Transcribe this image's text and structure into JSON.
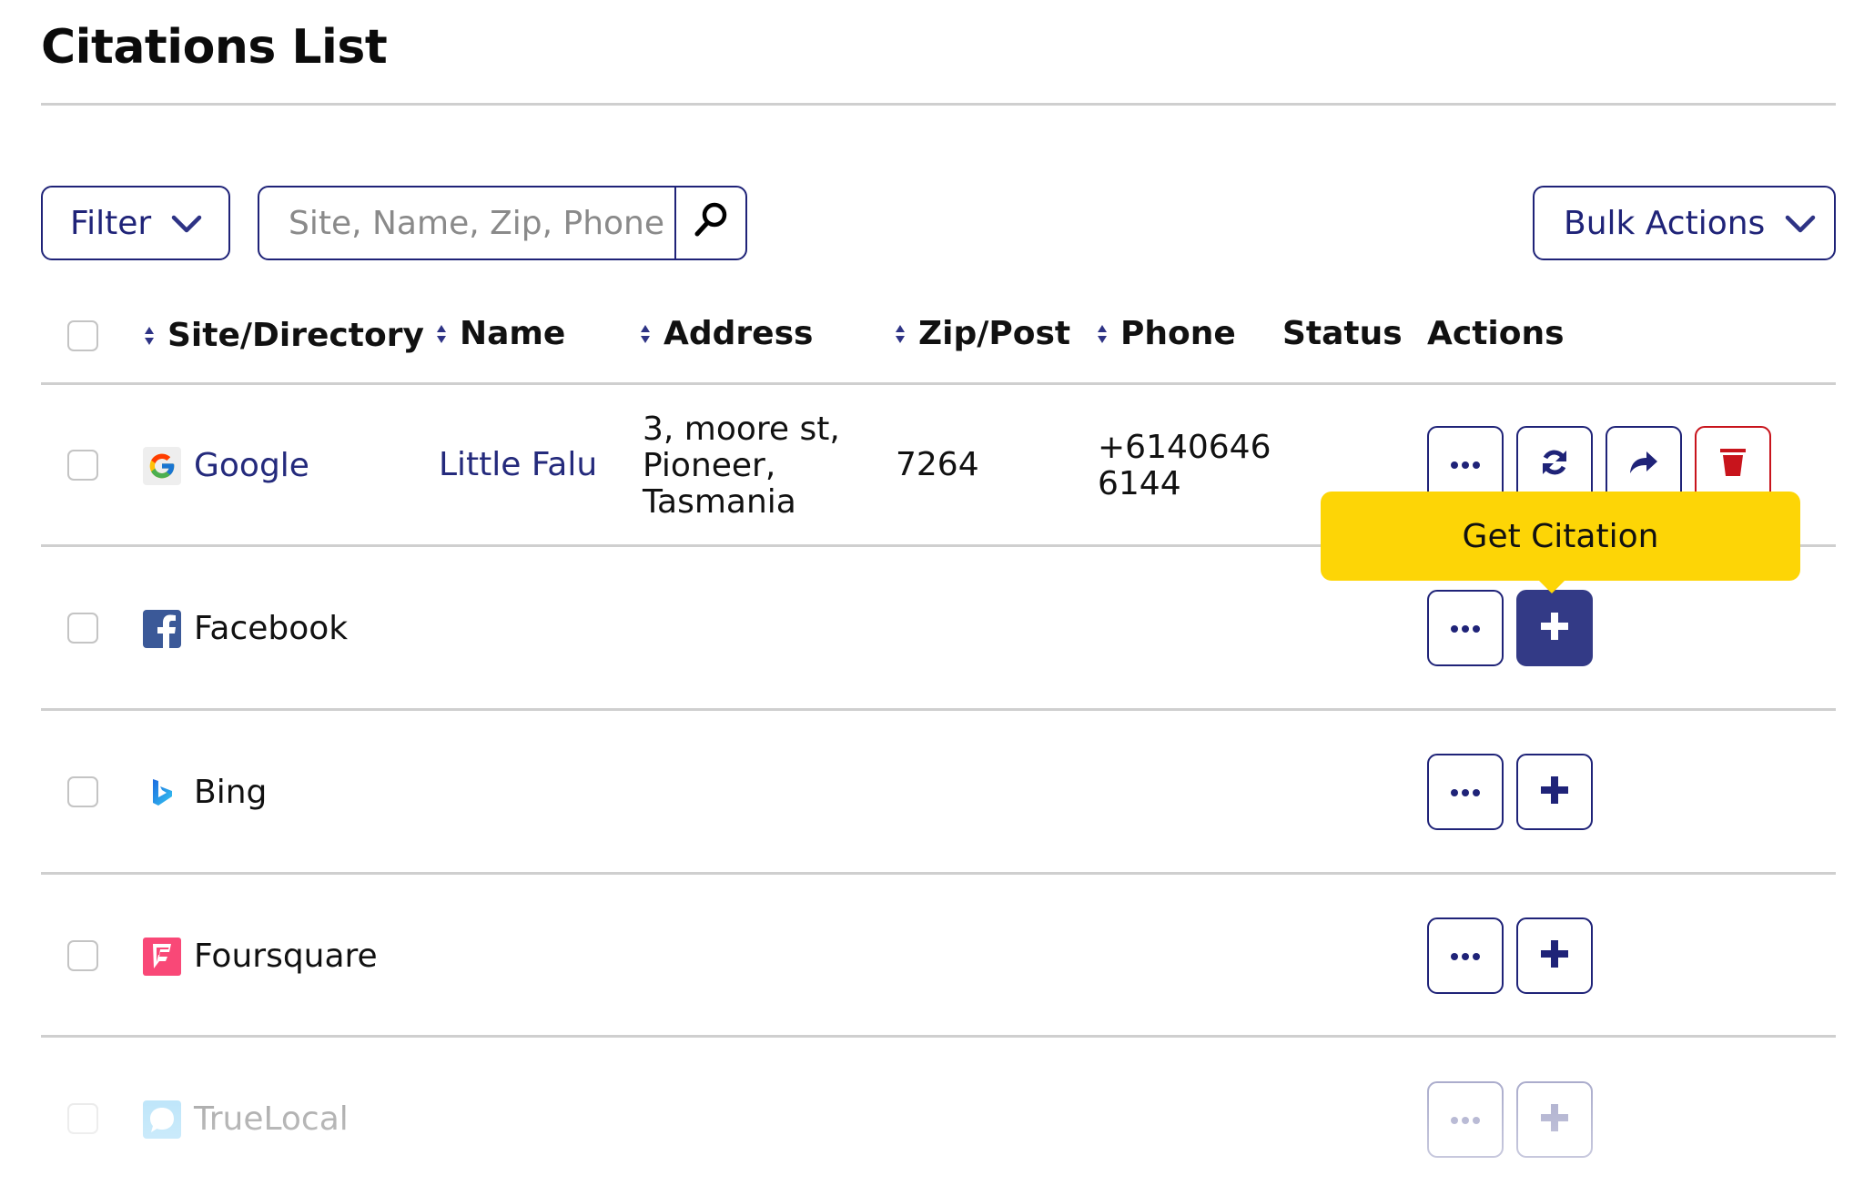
{
  "page": {
    "title": "Citations List"
  },
  "toolbar": {
    "filter_label": "Filter",
    "search_placeholder": "Site, Name, Zip, Phone",
    "search_value": "",
    "bulk_actions_label": "Bulk Actions"
  },
  "table": {
    "columns": [
      {
        "label": "Site/Directory",
        "sortable": true
      },
      {
        "label": "Name",
        "sortable": true
      },
      {
        "label": "Address",
        "sortable": true
      },
      {
        "label": "Zip/Post",
        "sortable": true
      },
      {
        "label": "Phone",
        "sortable": true
      },
      {
        "label": "Status",
        "sortable": false
      },
      {
        "label": "Actions",
        "sortable": false
      }
    ],
    "rows": [
      {
        "site": "Google",
        "site_icon": "google-icon",
        "name": "Little Falu",
        "address": [
          "3, moore st,",
          "Pioneer,",
          "Tasmania"
        ],
        "zip": "7264",
        "phone": [
          "+6140646",
          "6144"
        ],
        "status": "",
        "actions": [
          "more",
          "refresh",
          "share",
          "delete"
        ]
      },
      {
        "site": "Facebook",
        "site_icon": "facebook-icon",
        "name": "",
        "zip": "",
        "status": "",
        "actions": [
          "more",
          "add"
        ]
      },
      {
        "site": "Bing",
        "site_icon": "bing-icon",
        "name": "",
        "zip": "",
        "status": "",
        "actions": [
          "more",
          "add"
        ]
      },
      {
        "site": "Foursquare",
        "site_icon": "foursquare-icon",
        "name": "",
        "zip": "",
        "status": "",
        "actions": [
          "more",
          "add"
        ]
      },
      {
        "site": "TrueLocal",
        "site_icon": "truelocal-icon",
        "name": "",
        "zip": "",
        "status": "",
        "actions": [
          "more",
          "add"
        ]
      }
    ]
  },
  "tooltip": {
    "text": "Get Citation"
  },
  "colors": {
    "primary": "#1f2378",
    "primary_filled": "#333a86",
    "danger": "#c8141c",
    "tooltip_bg": "#fdd506",
    "divider": "#cfcfcf"
  }
}
